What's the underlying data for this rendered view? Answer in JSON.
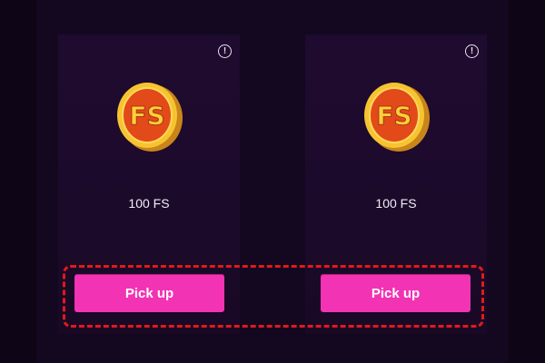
{
  "colors": {
    "background": "#0e0516",
    "card": "#1f0b2f",
    "button": "#f233b4",
    "highlight": "#e01a1a",
    "coin_gold": "#f6c431",
    "coin_red": "#e24a1a"
  },
  "cards": [
    {
      "icon": "fs-coin-icon",
      "coin_text": "FS",
      "amount": "100 FS",
      "button_label": "Pick up"
    },
    {
      "icon": "fs-coin-icon",
      "coin_text": "FS",
      "amount": "100 FS",
      "button_label": "Pick up"
    }
  ]
}
